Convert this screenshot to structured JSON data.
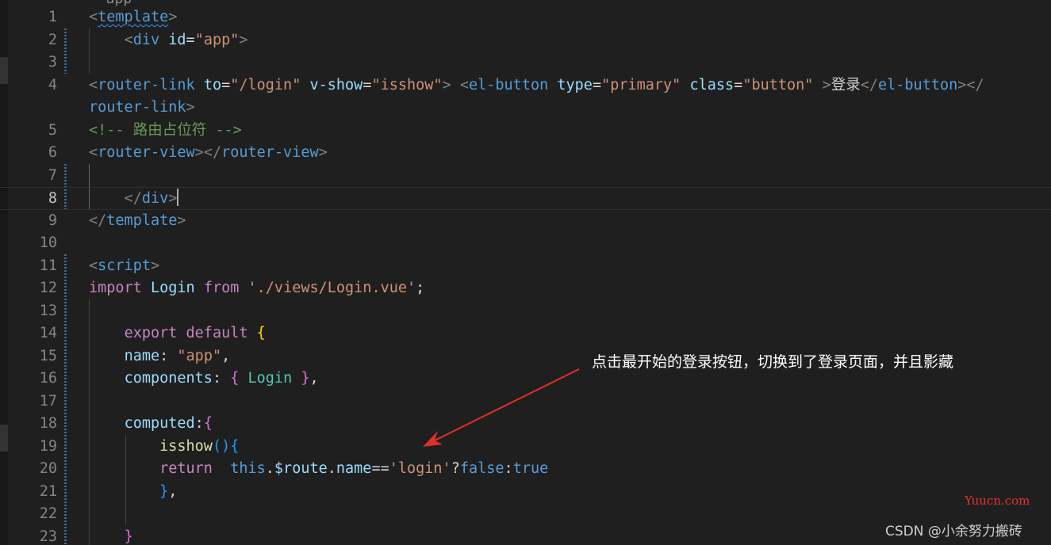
{
  "top_peek": "  app                        ",
  "lines": [
    {
      "n": "1"
    },
    {
      "n": "2"
    },
    {
      "n": "3"
    },
    {
      "n": "4"
    },
    {
      "n": "5"
    },
    {
      "n": "6"
    },
    {
      "n": "7"
    },
    {
      "n": "8"
    },
    {
      "n": "9"
    },
    {
      "n": "10"
    },
    {
      "n": "11"
    },
    {
      "n": "12"
    },
    {
      "n": "13"
    },
    {
      "n": "14"
    },
    {
      "n": "15"
    },
    {
      "n": "16"
    },
    {
      "n": "17"
    },
    {
      "n": "18"
    },
    {
      "n": "19"
    },
    {
      "n": "20"
    },
    {
      "n": "21"
    },
    {
      "n": "22"
    },
    {
      "n": "23"
    }
  ],
  "code": {
    "l1": [
      "<",
      "template",
      ">"
    ],
    "l2": [
      "    ",
      "<",
      "div",
      " ",
      "id",
      "=",
      "\"app\"",
      ">"
    ],
    "l4": [
      "<",
      "router-link",
      " ",
      "to",
      "=",
      "\"/login\"",
      " ",
      "v-show",
      "=",
      "\"isshow\"",
      ">",
      " ",
      "<",
      "el-button",
      " ",
      "type",
      "=",
      "\"primary\"",
      " ",
      "class",
      "=",
      "\"button\"",
      " ",
      ">",
      "登录",
      "</",
      "el-button",
      "></"
    ],
    "l4b": [
      "router-link",
      ">"
    ],
    "l5": "<!-- 路由占位符 -->",
    "l6": [
      "<",
      "router-view",
      "></",
      "router-view",
      ">"
    ],
    "l8": [
      "    ",
      "</",
      "div",
      ">"
    ],
    "l9": [
      "</",
      "template",
      ">"
    ],
    "l11": [
      "<",
      "script",
      ">"
    ],
    "l12": [
      "import",
      " ",
      "Login",
      " ",
      "from",
      " ",
      "'./views/Login.vue'",
      ";"
    ],
    "l14": [
      "    ",
      "export",
      " ",
      "default",
      " ",
      "{"
    ],
    "l15": [
      "    ",
      "name",
      ": ",
      "\"app\"",
      ","
    ],
    "l16": [
      "    ",
      "components",
      ": ",
      "{",
      " ",
      "Login",
      " ",
      "}",
      ","
    ],
    "l18": [
      "    ",
      "computed",
      ":",
      "{"
    ],
    "l19": [
      "        ",
      "isshow",
      "()",
      "{"
    ],
    "l20": [
      "        ",
      "return",
      "  ",
      "this",
      ".",
      "$route",
      ".",
      "name",
      "==",
      "'login'",
      "?",
      "false",
      ":",
      "true"
    ],
    "l21": [
      "        ",
      "}",
      ","
    ],
    "l23": [
      "    ",
      "}"
    ]
  },
  "annotation": "点击最开始的登录按钮，切换到了登录页面，并且影藏",
  "watermarks": {
    "site": "Yuucn.com",
    "csdn": "CSDN @小余努力搬砖"
  },
  "colors": {
    "background": "#1f1f1f",
    "arrow": "#e0302b",
    "tag": "#569cd6",
    "attribute": "#9cdcfe",
    "string": "#ce9178",
    "comment": "#6a9955",
    "keyword": "#c586c0"
  }
}
